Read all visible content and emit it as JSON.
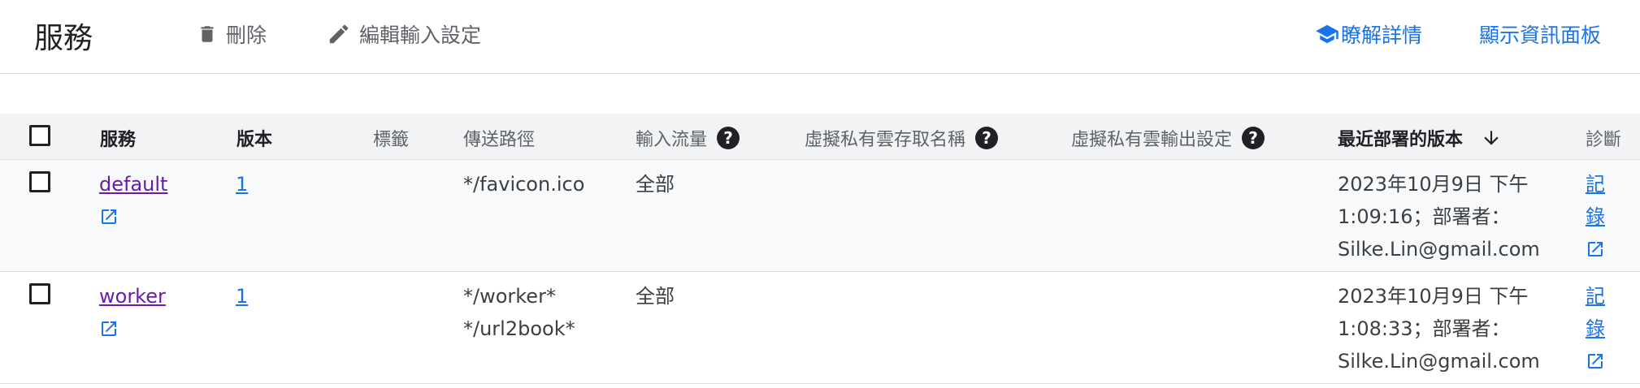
{
  "header": {
    "title": "服務",
    "delete_label": "刪除",
    "edit_ingress_label": "編輯輸入設定",
    "learn_more_label": "瞭解詳情",
    "show_dashboard_label": "顯示資訊面板"
  },
  "colors": {
    "accent": "#1a73e8",
    "visited_link": "#681da8",
    "header_bg": "#f1f3f4",
    "row_alt_bg": "#f8f9fa"
  },
  "table": {
    "columns": {
      "service": "服務",
      "version": "版本",
      "labels": "標籤",
      "dispatch_route": "傳送路徑",
      "ingress": "輸入流量",
      "vpc_connector": "虛擬私有雲存取名稱",
      "vpc_egress": "虛擬私有雲輸出設定",
      "last_deployed": "最近部署的版本",
      "diagnose": "診斷"
    },
    "rows": [
      {
        "service": "default",
        "version": "1",
        "route_1": "*/favicon.ico",
        "route_2": "",
        "ingress": "全部",
        "deployed_1": "2023年10月9日 下午",
        "deployed_2": "1:09:16；部署者：",
        "deployed_3": "Silke.Lin@gmail.com",
        "diag_1": "記",
        "diag_2": "錄"
      },
      {
        "service": "worker",
        "version": "1",
        "route_1": "*/worker*",
        "route_2": "*/url2book*",
        "ingress": "全部",
        "deployed_1": "2023年10月9日 下午",
        "deployed_2": "1:08:33；部署者：",
        "deployed_3": "Silke.Lin@gmail.com",
        "diag_1": "記",
        "diag_2": "錄"
      }
    ]
  },
  "icons": [
    "trash-icon",
    "pencil-icon",
    "school-icon",
    "help-icon",
    "arrow-down-icon",
    "open-in-new-icon"
  ]
}
